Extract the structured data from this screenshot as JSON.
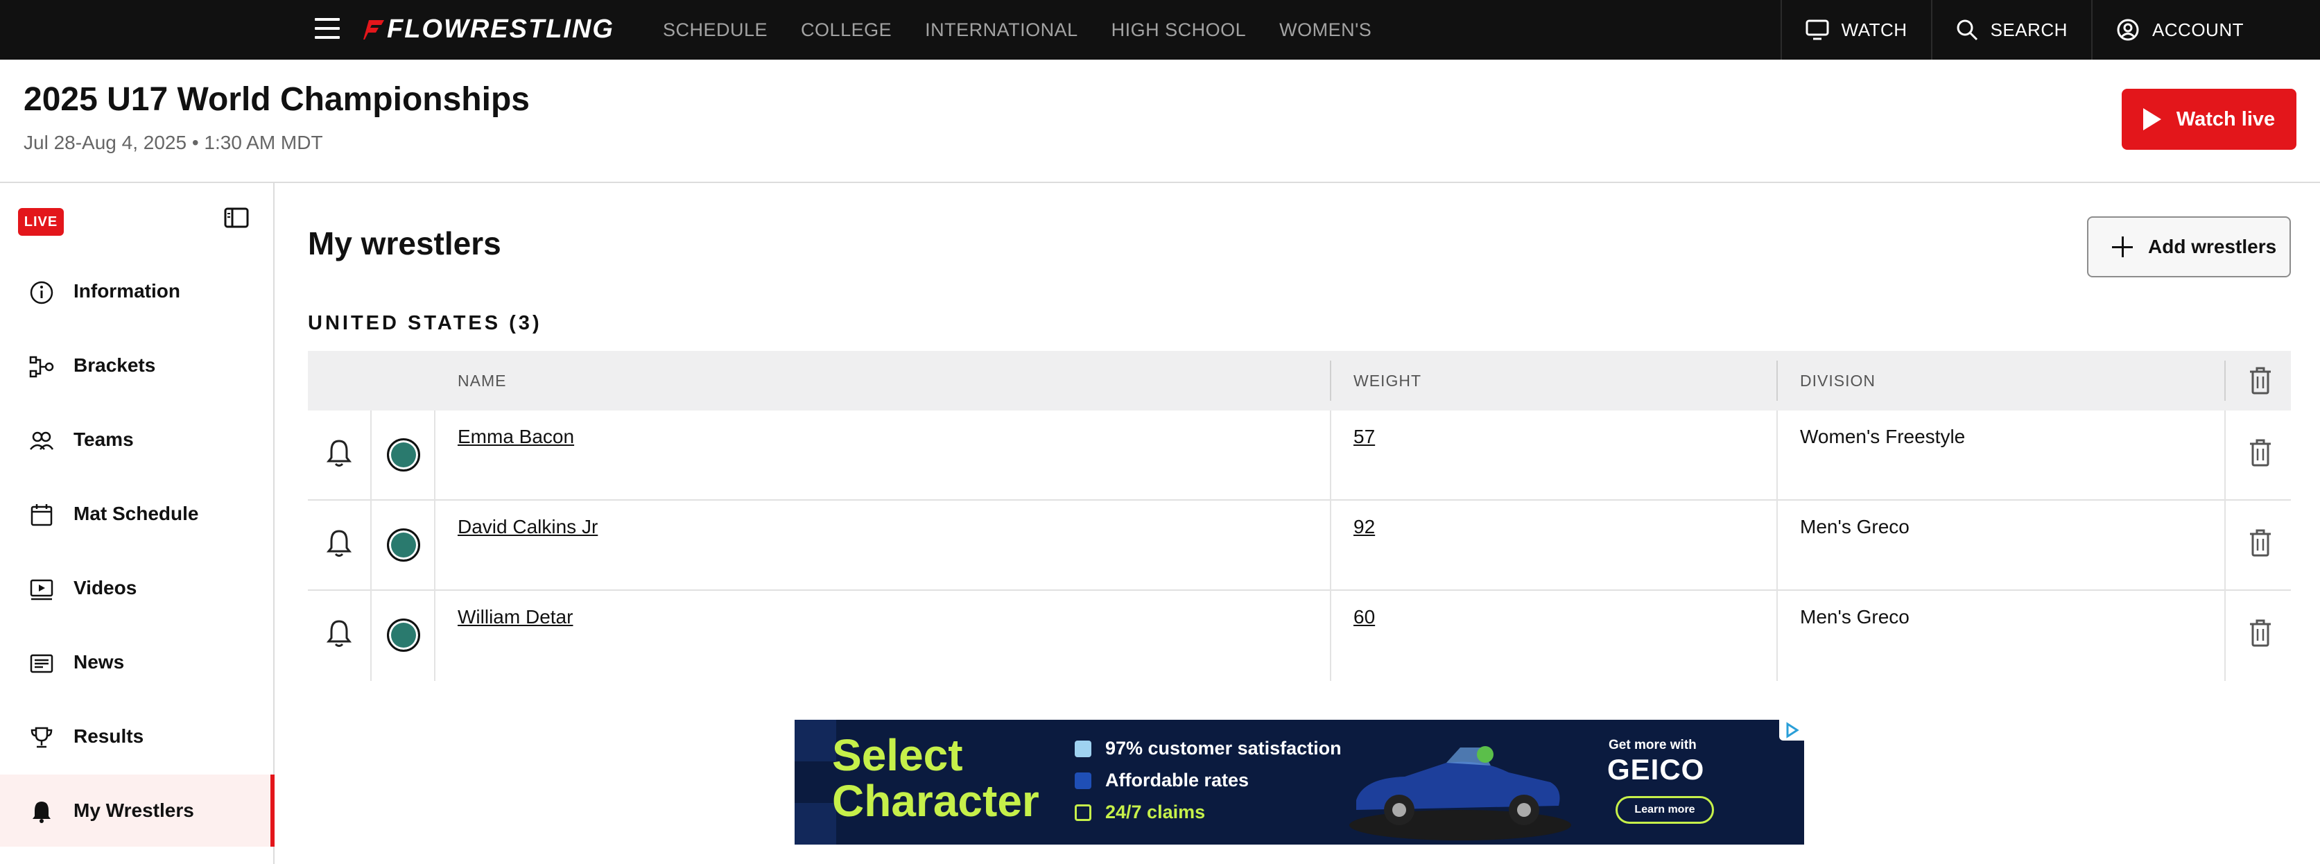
{
  "topnav": {
    "logo": "FLOWRESTLING",
    "links": [
      "SCHEDULE",
      "COLLEGE",
      "INTERNATIONAL",
      "HIGH SCHOOL",
      "WOMEN'S"
    ],
    "watch": "WATCH",
    "search": "SEARCH",
    "account": "ACCOUNT"
  },
  "event": {
    "title": "2025 U17 World Championships",
    "subtitle": "Jul 28-Aug 4, 2025 • 1:30 AM MDT",
    "watch_live": "Watch live"
  },
  "sidebar": {
    "live_badge": "LIVE",
    "items": [
      {
        "label": "Information",
        "icon": "info-icon"
      },
      {
        "label": "Brackets",
        "icon": "brackets-icon"
      },
      {
        "label": "Teams",
        "icon": "teams-icon"
      },
      {
        "label": "Mat Schedule",
        "icon": "calendar-icon"
      },
      {
        "label": "Videos",
        "icon": "video-icon"
      },
      {
        "label": "News",
        "icon": "news-icon"
      },
      {
        "label": "Results",
        "icon": "trophy-icon"
      },
      {
        "label": "My Wrestlers",
        "icon": "bell-filled-icon",
        "active": true
      }
    ]
  },
  "main": {
    "title": "My wrestlers",
    "add_button": "Add wrestlers",
    "country_heading": "UNITED STATES (3)",
    "columns": {
      "name": "NAME",
      "weight": "WEIGHT",
      "division": "DIVISION"
    },
    "rows": [
      {
        "name": "Emma Bacon",
        "weight": "57",
        "division": "Women's Freestyle"
      },
      {
        "name": "David Calkins Jr",
        "weight": "92",
        "division": "Men's Greco"
      },
      {
        "name": "William Detar",
        "weight": "60",
        "division": "Men's Greco"
      }
    ]
  },
  "ad": {
    "headline_1": "Select",
    "headline_2": "Character",
    "line_1": "97% customer satisfaction",
    "line_2": "Affordable rates",
    "line_3": "24/7 claims",
    "get_more": "Get more with",
    "brand": "GEICO",
    "cta": "Learn more"
  },
  "colors": {
    "brand_red": "#e3161b",
    "nav_bg": "#111111",
    "ad_bg": "#0b1b3f",
    "ad_accent": "#c6f04a",
    "status_dot": "#2a7a6e"
  }
}
